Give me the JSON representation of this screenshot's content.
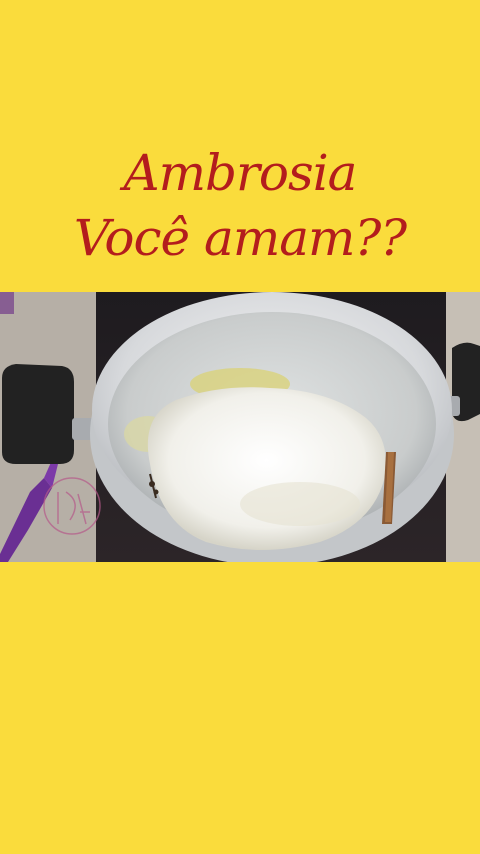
{
  "overlay_text": {
    "line1": "Ambrosia",
    "line2": "Você amam??"
  },
  "photo": {
    "subject": "aluminum saucepan with milk and sugar on a stovetop",
    "watermark_icon": "circular-monogram-watermark"
  },
  "colors": {
    "background": "#fadc3c",
    "title_text": "#b31d1d"
  }
}
